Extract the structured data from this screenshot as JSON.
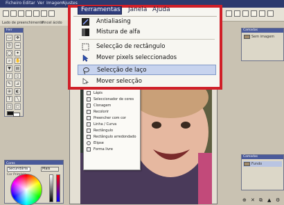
{
  "app": {
    "menubar_items": [
      "Ficheiro",
      "Editar",
      "Ver",
      "Imagem",
      "Ajustes"
    ],
    "toolbar_left_labels": [
      "Lado de preenchimento",
      "Pincel ácido"
    ],
    "tools_panel_title": "Ferr",
    "colors_panel_title": "Cores",
    "colors_mode": "Secundária",
    "colors_more_button": "Mais",
    "colors_primary_label": "Cor Primária",
    "layers_panel_title": "Camadas",
    "layers_item": "Sem imagem",
    "history_panel_title": "Camadas",
    "history_item": "Fundo"
  },
  "menu": {
    "top_items": [
      {
        "label": "Ferramentas",
        "selected": true
      },
      {
        "label": "Janela",
        "selected": false
      },
      {
        "label": "Ajuda",
        "selected": false
      }
    ],
    "dropdown_items": [
      {
        "label": "Antialiasing",
        "icon": "antialiasing-icon",
        "highlighted": false
      },
      {
        "label": "Mistura de alfa",
        "icon": "alpha-blend-icon",
        "highlighted": false
      },
      {
        "label": "Selecção de rectângulo",
        "icon": "rect-select-icon",
        "highlighted": false
      },
      {
        "label": "Mover pixels seleccionados",
        "icon": "move-pixels-icon",
        "highlighted": false
      },
      {
        "label": "Selecção de laço",
        "icon": "lasso-icon",
        "highlighted": true
      },
      {
        "label": "Mover selecção",
        "icon": "move-selection-icon",
        "highlighted": false
      }
    ]
  },
  "submenu": {
    "items": [
      {
        "label": "Lápis",
        "icon": "pencil-icon"
      },
      {
        "label": "Seleccionador de cores",
        "icon": "color-picker-icon"
      },
      {
        "label": "Clonagem",
        "icon": "clone-stamp-icon"
      },
      {
        "label": "Recolorir",
        "icon": "recolor-icon"
      },
      {
        "label": "Preencher com cor",
        "icon": "paint-bucket-icon"
      },
      {
        "label": "Linha / Curva",
        "icon": "line-curve-icon"
      },
      {
        "label": "Rectângulo",
        "icon": "rectangle-icon"
      },
      {
        "label": "Rectângulo arredondado",
        "icon": "rounded-rectangle-icon"
      },
      {
        "label": "Elipse",
        "icon": "ellipse-icon"
      },
      {
        "label": "Forma livre",
        "icon": "freeform-icon"
      }
    ]
  },
  "colors": {
    "frame_red": "#d01f28",
    "menu_selected": "#2f3d7c",
    "highlight": "#c7d3ee"
  }
}
